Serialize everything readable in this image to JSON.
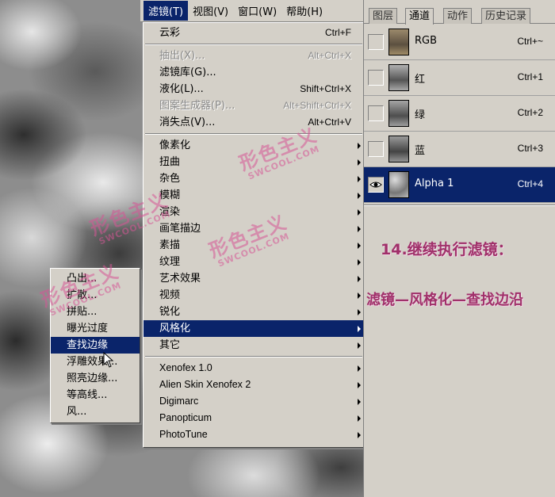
{
  "menubar": {
    "items": [
      {
        "label": "滤镜(T)",
        "active": true
      },
      {
        "label": "视图(V)",
        "active": false
      },
      {
        "label": "窗口(W)",
        "active": false
      },
      {
        "label": "帮助(H)",
        "active": false
      }
    ]
  },
  "filter_menu": {
    "last_filter": {
      "label": "云彩",
      "shortcut": "Ctrl+F"
    },
    "group1": [
      {
        "label": "抽出(X)...",
        "shortcut": "Alt+Ctrl+X",
        "disabled": true
      },
      {
        "label": "滤镜库(G)...",
        "shortcut": "",
        "disabled": false
      },
      {
        "label": "液化(L)...",
        "shortcut": "Shift+Ctrl+X",
        "disabled": false
      },
      {
        "label": "图案生成器(P)...",
        "shortcut": "Alt+Shift+Ctrl+X",
        "disabled": true
      },
      {
        "label": "消失点(V)...",
        "shortcut": "Alt+Ctrl+V",
        "disabled": false
      }
    ],
    "group2": [
      {
        "label": "像素化",
        "selected": false
      },
      {
        "label": "扭曲",
        "selected": false
      },
      {
        "label": "杂色",
        "selected": false
      },
      {
        "label": "模糊",
        "selected": false
      },
      {
        "label": "渲染",
        "selected": false
      },
      {
        "label": "画笔描边",
        "selected": false
      },
      {
        "label": "素描",
        "selected": false
      },
      {
        "label": "纹理",
        "selected": false
      },
      {
        "label": "艺术效果",
        "selected": false
      },
      {
        "label": "视频",
        "selected": false
      },
      {
        "label": "锐化",
        "selected": false
      },
      {
        "label": "风格化",
        "selected": true
      },
      {
        "label": "其它",
        "selected": false
      }
    ],
    "group3": [
      {
        "label": "Xenofex 1.0"
      },
      {
        "label": "Alien Skin Xenofex 2"
      },
      {
        "label": "Digimarc"
      },
      {
        "label": "Panopticum"
      },
      {
        "label": "PhotoTune"
      }
    ]
  },
  "stylize_menu": {
    "items": [
      {
        "label": "凸出...",
        "selected": false
      },
      {
        "label": "扩散...",
        "selected": false
      },
      {
        "label": "拼贴...",
        "selected": false
      },
      {
        "label": "曝光过度",
        "selected": false
      },
      {
        "label": "查找边缘",
        "selected": true
      },
      {
        "label": "浮雕效果...",
        "selected": false
      },
      {
        "label": "照亮边缘...",
        "selected": false
      },
      {
        "label": "等高线...",
        "selected": false
      },
      {
        "label": "风...",
        "selected": false
      }
    ]
  },
  "panel": {
    "tabs": [
      {
        "label": "图层",
        "active": false
      },
      {
        "label": "通道",
        "active": true
      },
      {
        "label": "动作",
        "active": false
      },
      {
        "label": "历史记录",
        "active": false
      }
    ],
    "channels": [
      {
        "name": "RGB",
        "shortcut": "Ctrl+~",
        "visible": false,
        "selected": false
      },
      {
        "name": "红",
        "shortcut": "Ctrl+1",
        "visible": false,
        "selected": false
      },
      {
        "name": "绿",
        "shortcut": "Ctrl+2",
        "visible": false,
        "selected": false
      },
      {
        "name": "蓝",
        "shortcut": "Ctrl+3",
        "visible": false,
        "selected": false
      },
      {
        "name": "Alpha 1",
        "shortcut": "Ctrl+4",
        "visible": true,
        "selected": true
      }
    ]
  },
  "tutorial": {
    "step_title": "14.继续执行滤镜：",
    "step_path": "滤镜—风格化—查找边沿"
  },
  "watermark": {
    "logo": "形色主义",
    "site": "SWCOOL.COM"
  },
  "colors": {
    "menu_bg": "#d4d0c8",
    "highlight": "#0a246a",
    "step_text": "#a0306a",
    "watermark": "#d65696"
  }
}
